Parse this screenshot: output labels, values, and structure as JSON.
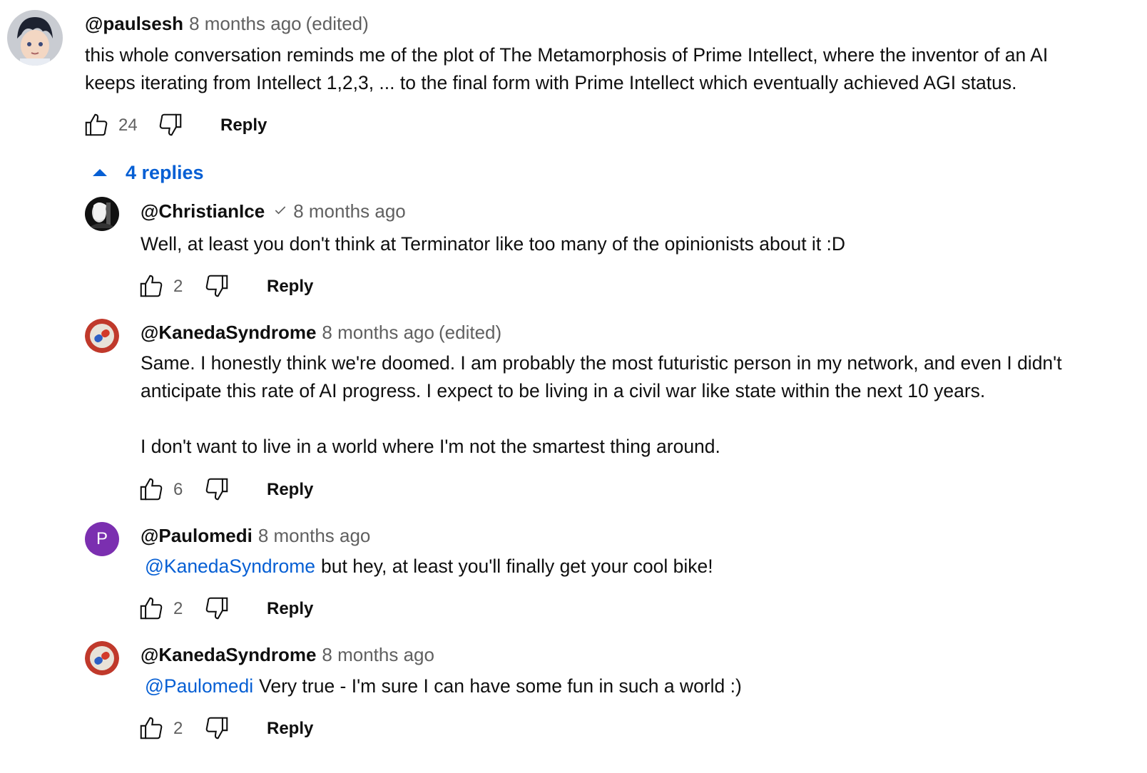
{
  "colors": {
    "link": "#065fd4",
    "meta": "#606060",
    "text": "#0f0f0f",
    "paulomedi_avatar": "#7b2fb0",
    "kaneda_avatar": "#c0392b"
  },
  "top_comment": {
    "author": "@paulsesh",
    "time": "8 months ago",
    "edited": "(edited)",
    "text": "this whole conversation reminds me of the plot of The Metamorphosis of Prime Intellect, where the inventor of an AI keeps iterating from Intellect 1,2,3, ... to the final form with Prime Intellect which eventually achieved AGI status.",
    "likes": "24",
    "reply_label": "Reply",
    "avatar_icon": "anime-avatar-icon"
  },
  "replies_toggle": {
    "label": "4 replies",
    "icon": "caret-up-icon"
  },
  "replies": [
    {
      "author": "@ChristianIce",
      "time": "8 months ago",
      "text": "Well, at least you don't think at Terminator like too many of the opinionists about it :D",
      "likes": "2",
      "reply_label": "Reply",
      "verified_icon": "checkmark-icon"
    },
    {
      "author": "@KanedaSyndrome",
      "time": "8 months ago",
      "edited": "(edited)",
      "text": "Same. I honestly think we're doomed. I am probably the most futuristic person in my network, and even I didn't anticipate this rate of AI progress. I expect to be living in a civil war like state within the next 10 years.\n\nI don't want to live in a world where I'm not the smartest thing around.",
      "likes": "6",
      "reply_label": "Reply"
    },
    {
      "author": "@Paulomedi",
      "time": "8 months ago",
      "avatar_letter": "P",
      "mention": "@KanedaSyndrome",
      "text": "but hey, at least you'll finally get your cool bike!",
      "likes": "2",
      "reply_label": "Reply"
    },
    {
      "author": "@KanedaSyndrome",
      "time": "8 months ago",
      "mention": "@Paulomedi",
      "text": "Very true - I'm sure I can have some fun in such a world :)",
      "likes": "2",
      "reply_label": "Reply"
    }
  ]
}
